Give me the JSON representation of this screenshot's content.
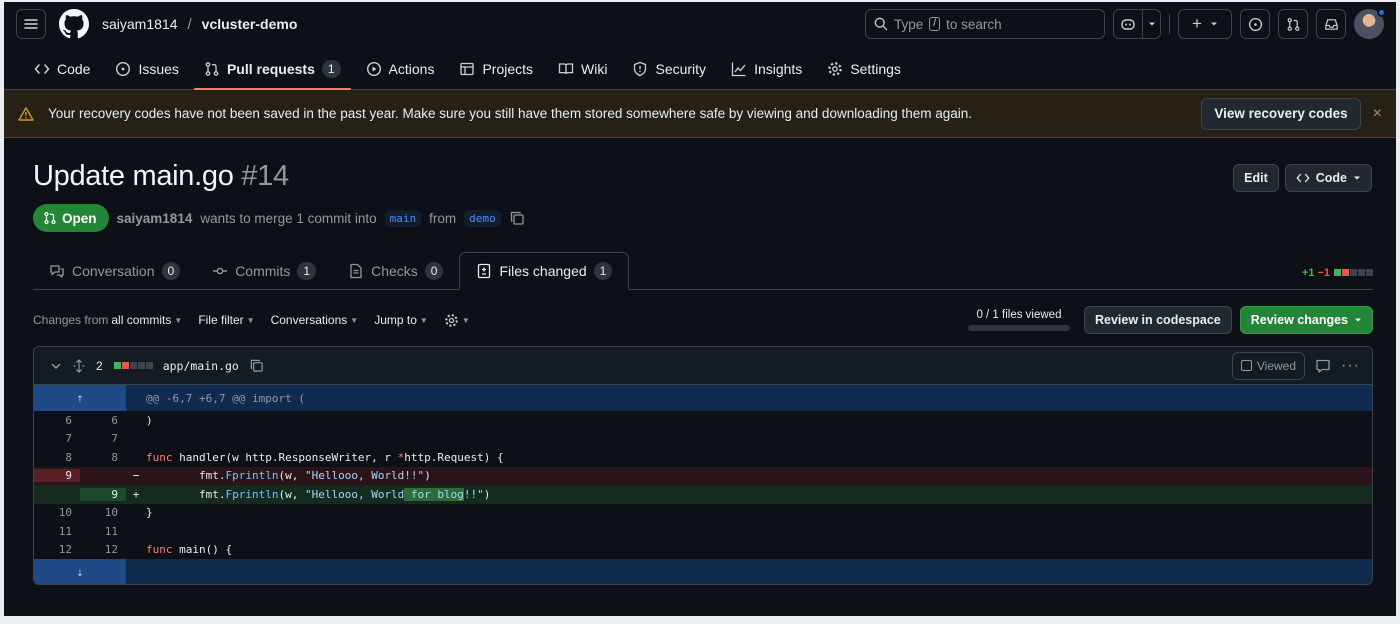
{
  "header": {
    "owner": "saiyam1814",
    "separator": "/",
    "repo": "vcluster-demo",
    "search_prefix": "Type",
    "search_key": "/",
    "search_suffix": "to search",
    "plus_label": "+"
  },
  "repo_nav": [
    {
      "label": "Code",
      "icon": "code-icon"
    },
    {
      "label": "Issues",
      "icon": "issue-icon"
    },
    {
      "label": "Pull requests",
      "icon": "pull-request-icon",
      "count": "1",
      "active": true
    },
    {
      "label": "Actions",
      "icon": "play-icon"
    },
    {
      "label": "Projects",
      "icon": "table-icon"
    },
    {
      "label": "Wiki",
      "icon": "book-icon"
    },
    {
      "label": "Security",
      "icon": "shield-icon"
    },
    {
      "label": "Insights",
      "icon": "graph-icon"
    },
    {
      "label": "Settings",
      "icon": "gear-icon"
    }
  ],
  "banner": {
    "text": "Your recovery codes have not been saved in the past year. Make sure you still have them stored somewhere safe by viewing and downloading them again.",
    "button": "View recovery codes",
    "close": "×"
  },
  "pr": {
    "title": "Update main.go",
    "number": "#14",
    "state": "Open",
    "author": "saiyam1814",
    "merge_text": "wants to merge 1 commit into",
    "base": "main",
    "from_text": "from",
    "head": "demo",
    "edit_button": "Edit",
    "code_button": "Code"
  },
  "tabs": [
    {
      "label": "Conversation",
      "count": "0",
      "icon": "comment-icon"
    },
    {
      "label": "Commits",
      "count": "1",
      "icon": "commit-icon"
    },
    {
      "label": "Checks",
      "count": "0",
      "icon": "checklist-icon"
    },
    {
      "label": "Files changed",
      "count": "1",
      "icon": "file-diff-icon",
      "active": true
    }
  ],
  "diffstat": {
    "additions": "+1",
    "deletions": "−1"
  },
  "toolbar": {
    "changes_prefix": "Changes from",
    "changes_value": "all commits",
    "file_filter": "File filter",
    "conversations": "Conversations",
    "jump_to": "Jump to",
    "files_viewed": "0 / 1 files viewed",
    "files_viewed_fraction": 0,
    "review_codespace": "Review in codespace",
    "review_changes": "Review changes"
  },
  "file": {
    "changes": "2",
    "path": "app/main.go",
    "viewed_label": "Viewed",
    "hunk_header": "@@ -6,7 +6,7 @@ import (",
    "lines": [
      {
        "old": "6",
        "new": "6",
        "sign": "",
        "type": "ctx",
        "code": ")"
      },
      {
        "old": "7",
        "new": "7",
        "sign": "",
        "type": "ctx",
        "code": ""
      },
      {
        "old": "8",
        "new": "8",
        "sign": "",
        "type": "ctx",
        "code": "func handler(w http.ResponseWriter, r *http.Request) {"
      },
      {
        "old": "9",
        "new": "",
        "sign": "−",
        "type": "del",
        "code": "        fmt.Fprintln(w, \"Hellooo, World!!\")"
      },
      {
        "old": "",
        "new": "9",
        "sign": "+",
        "type": "add",
        "code": "        fmt.Fprintln(w, \"Hellooo, World for blog!!\")"
      },
      {
        "old": "10",
        "new": "10",
        "sign": "",
        "type": "ctx",
        "code": "}"
      },
      {
        "old": "11",
        "new": "11",
        "sign": "",
        "type": "ctx",
        "code": ""
      },
      {
        "old": "12",
        "new": "12",
        "sign": "",
        "type": "ctx",
        "code": "func main() {"
      }
    ]
  },
  "colors": {
    "background": "#0d1117",
    "accent_green": "#238636",
    "accent_link": "#4493f8",
    "tab_underline": "#f78166",
    "warning_bg": "#272115"
  }
}
